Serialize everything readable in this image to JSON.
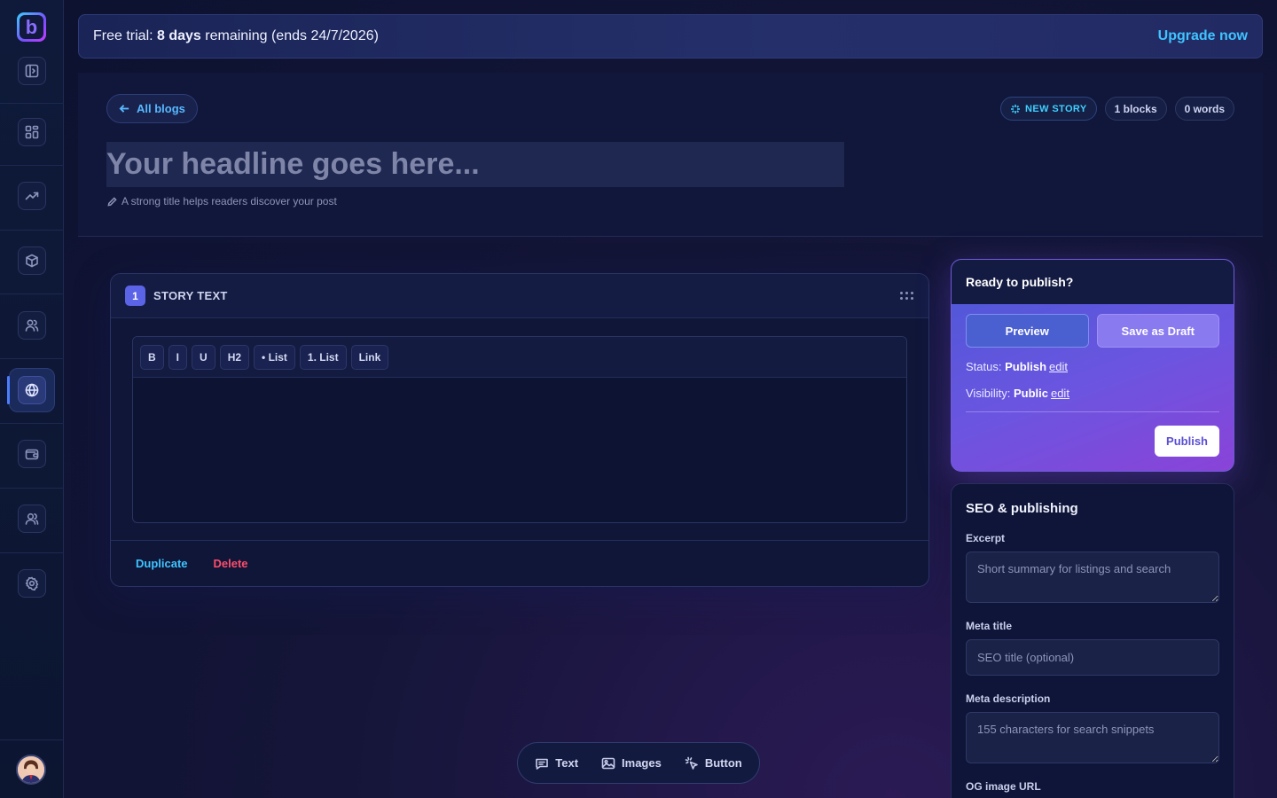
{
  "app": {
    "logo_letter": "b"
  },
  "sidebar": {
    "items": [
      {
        "name": "dashboard",
        "icon": "grid-icon"
      },
      {
        "name": "analytics",
        "icon": "trending-up-icon"
      },
      {
        "name": "products",
        "icon": "box-icon"
      },
      {
        "name": "users",
        "icon": "users-icon"
      },
      {
        "name": "sites",
        "icon": "globe-icon",
        "active": true
      },
      {
        "name": "wallet",
        "icon": "wallet-icon"
      },
      {
        "name": "team",
        "icon": "team-icon"
      },
      {
        "name": "settings",
        "icon": "gear-icon"
      }
    ]
  },
  "trial": {
    "prefix": "Free trial: ",
    "days": "8 days",
    "suffix": " remaining (ends 24/7/2026)",
    "upgrade_label": "Upgrade now"
  },
  "header": {
    "back_label": "All blogs",
    "badge_new": "NEW STORY",
    "badge_blocks": "1 blocks",
    "badge_words": "0 words",
    "headline_placeholder": "Your headline goes here...",
    "hint": "A strong title helps readers discover your post"
  },
  "block": {
    "number": "1",
    "title": "STORY TEXT",
    "toolbar": [
      "B",
      "I",
      "U",
      "H2",
      "• List",
      "1. List",
      "Link"
    ],
    "duplicate_label": "Duplicate",
    "delete_label": "Delete"
  },
  "publish": {
    "title": "Ready to publish?",
    "preview_label": "Preview",
    "draft_label": "Save as Draft",
    "status_label": "Status: ",
    "status_value": "Publish",
    "visibility_label": "Visibility: ",
    "visibility_value": "Public",
    "edit_label": "edit",
    "publish_label": "Publish"
  },
  "seo": {
    "title": "SEO & publishing",
    "excerpt_label": "Excerpt",
    "excerpt_placeholder": "Short summary for listings and search",
    "meta_title_label": "Meta title",
    "meta_title_placeholder": "SEO title (optional)",
    "meta_desc_label": "Meta description",
    "meta_desc_placeholder": "155 characters for search snippets",
    "og_label": "OG image URL"
  },
  "addbar": {
    "text_label": "Text",
    "images_label": "Images",
    "button_label": "Button"
  }
}
